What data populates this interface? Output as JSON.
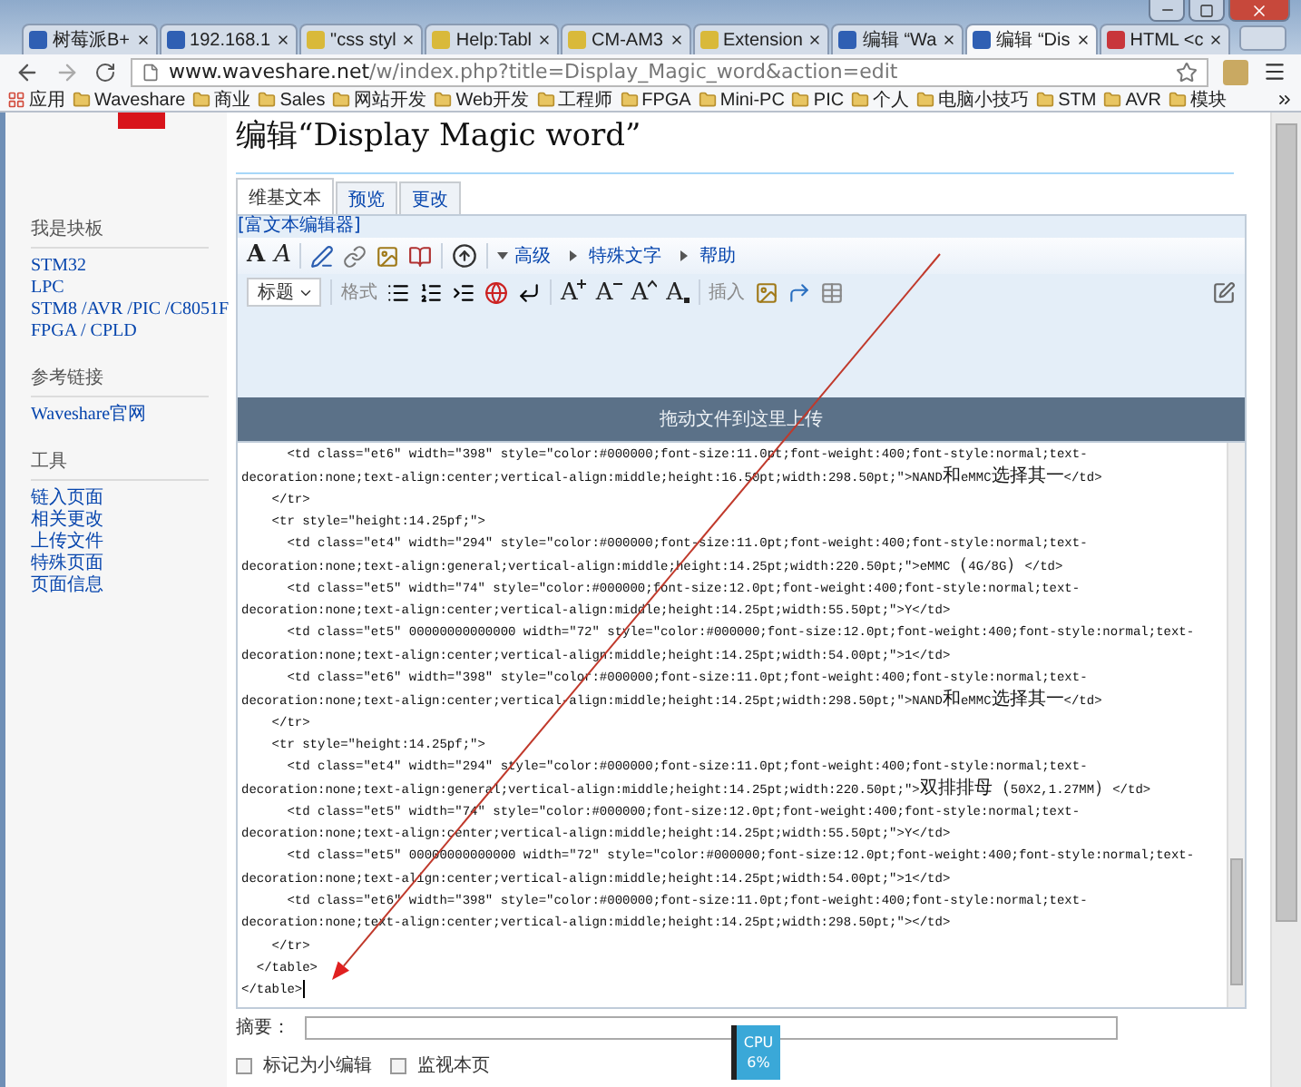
{
  "browser": {
    "tabs": [
      {
        "title": "树莓派B+",
        "color": "#2f5fb3",
        "selected": false
      },
      {
        "title": "192.168.1",
        "color": "#2f5fb3",
        "selected": false
      },
      {
        "title": "\"css styl",
        "color": "#d9b93a",
        "selected": false
      },
      {
        "title": "Help:Tabl",
        "color": "#d9b93a",
        "selected": false
      },
      {
        "title": "CM-AM3",
        "color": "#d9b93a",
        "selected": false
      },
      {
        "title": "Extension",
        "color": "#d9b93a",
        "selected": false
      },
      {
        "title": "编辑 “Wa",
        "color": "#2f5fb3",
        "selected": false
      },
      {
        "title": "编辑 “Dis",
        "color": "#2f5fb3",
        "selected": true
      },
      {
        "title": "HTML <c",
        "color": "#c8363b",
        "selected": false
      }
    ],
    "address": {
      "host": "www.waveshare.net",
      "path": "/w/index.php?title=Display_Magic_word&action=edit"
    },
    "bookmarks": [
      {
        "label": "应用",
        "kind": "apps"
      },
      {
        "label": "Waveshare",
        "kind": "folder"
      },
      {
        "label": "商业",
        "kind": "folder"
      },
      {
        "label": "Sales",
        "kind": "folder"
      },
      {
        "label": "网站开发",
        "kind": "folder"
      },
      {
        "label": "Web开发",
        "kind": "folder"
      },
      {
        "label": "工程师",
        "kind": "folder"
      },
      {
        "label": "FPGA",
        "kind": "folder"
      },
      {
        "label": "Mini-PC",
        "kind": "folder"
      },
      {
        "label": "PIC",
        "kind": "folder"
      },
      {
        "label": "个人",
        "kind": "folder"
      },
      {
        "label": "电脑小技巧",
        "kind": "folder"
      },
      {
        "label": "STM",
        "kind": "folder"
      },
      {
        "label": "AVR",
        "kind": "folder"
      },
      {
        "label": "模块",
        "kind": "folder"
      }
    ]
  },
  "sidebar": {
    "sections": [
      {
        "heading": "我是块板",
        "links": [
          "STM32",
          "LPC",
          "STM8 /AVR /PIC /C8051F",
          "FPGA / CPLD"
        ]
      },
      {
        "heading": "参考链接",
        "links": [
          "Waveshare官网"
        ]
      },
      {
        "heading": "工具",
        "links": [
          "链入页面",
          "相关更改",
          "上传文件",
          "特殊页面",
          "页面信息"
        ]
      }
    ]
  },
  "page": {
    "title": "编辑“Display Magic word”",
    "tabs": [
      {
        "label": "维基文本",
        "selected": true
      },
      {
        "label": "预览",
        "selected": false
      },
      {
        "label": "更改",
        "selected": false
      }
    ],
    "editor": {
      "rich_editor_link": "[富文本编辑器]",
      "style_buttons": [
        {
          "label": "A",
          "kind": "bold"
        },
        {
          "label": "A",
          "kind": "italic"
        }
      ],
      "menus": [
        "高级",
        "特殊文字",
        "帮助"
      ],
      "heading_select": "标题",
      "format_label": "格式",
      "size_buttons": [
        {
          "label": "A",
          "kind": "larger"
        },
        {
          "label": "A",
          "kind": "smaller"
        },
        {
          "label": "A",
          "kind": "superscript"
        },
        {
          "label": "A",
          "kind": "subscript"
        }
      ],
      "insert_label": "插入",
      "dropzone": "拖动文件到这里上传",
      "code_lines": [
        "      <td class=\"et6\" width=\"398\" style=\"color:#000000;font-size:11.0pt;font-weight:400;font-style:normal;text-",
        "decoration:none;text-align:center;vertical-align:middle;height:16.50pt;width:298.50pt;\">NAND和eMMC选择其一</td>",
        "    </tr>",
        "    <tr style=\"height:14.25pf;\">",
        "      <td class=\"et4\" width=\"294\" style=\"color:#000000;font-size:11.0pt;font-weight:400;font-style:normal;text-",
        "decoration:none;text-align:general;vertical-align:middle;height:14.25pt;width:220.50pt;\">eMMC（4G/8G）</td>",
        "      <td class=\"et5\" width=\"74\" style=\"color:#000000;font-size:12.0pt;font-weight:400;font-style:normal;text-",
        "decoration:none;text-align:center;vertical-align:middle;height:14.25pt;width:55.50pt;\">Y</td>",
        "      <td class=\"et5\" 00000000000000 width=\"72\" style=\"color:#000000;font-size:12.0pt;font-weight:400;font-style:normal;text-",
        "decoration:none;text-align:center;vertical-align:middle;height:14.25pt;width:54.00pt;\">1</td>",
        "      <td class=\"et6\" width=\"398\" style=\"color:#000000;font-size:11.0pt;font-weight:400;font-style:normal;text-",
        "decoration:none;text-align:center;vertical-align:middle;height:14.25pt;width:298.50pt;\">NAND和eMMC选择其一</td>",
        "    </tr>",
        "    <tr style=\"height:14.25pf;\">",
        "      <td class=\"et4\" width=\"294\" style=\"color:#000000;font-size:11.0pt;font-weight:400;font-style:normal;text-",
        "decoration:none;text-align:general;vertical-align:middle;height:14.25pt;width:220.50pt;\">双排排母（50X2,1.27MM）</td>",
        "      <td class=\"et5\" width=\"74\" style=\"color:#000000;font-size:12.0pt;font-weight:400;font-style:normal;text-",
        "decoration:none;text-align:center;vertical-align:middle;height:14.25pt;width:55.50pt;\">Y</td>",
        "      <td class=\"et5\" 00000000000000 width=\"72\" style=\"color:#000000;font-size:12.0pt;font-weight:400;font-style:normal;text-",
        "decoration:none;text-align:center;vertical-align:middle;height:14.25pt;width:54.00pt;\">1</td>",
        "      <td class=\"et6\" width=\"398\" style=\"color:#000000;font-size:11.0pt;font-weight:400;font-style:normal;text-",
        "decoration:none;text-align:center;vertical-align:middle;height:14.25pt;width:298.50pt;\"></td>",
        "    </tr>",
        "  </table>",
        "</table>"
      ]
    },
    "summary": {
      "label": "摘要："
    },
    "options": [
      {
        "label": "标记为小编辑",
        "checked": false
      },
      {
        "label": "监视本页",
        "checked": false
      }
    ]
  },
  "cpu": {
    "label": "CPU",
    "value": "6%"
  }
}
